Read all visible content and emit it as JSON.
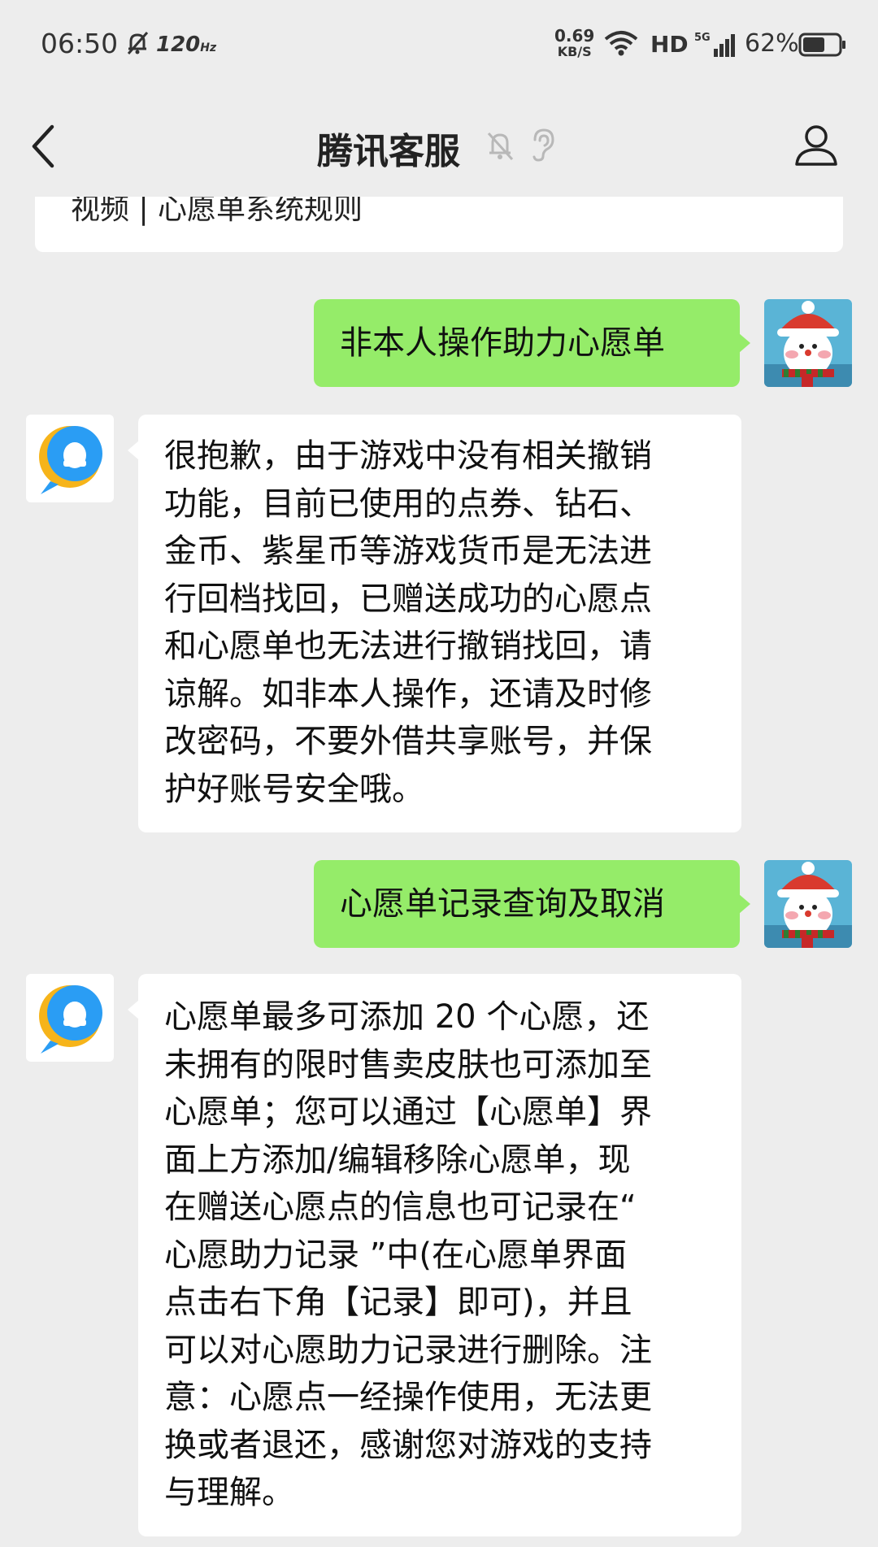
{
  "status_bar": {
    "time": "06:50",
    "refresh_rate": "120",
    "refresh_unit": "Hz",
    "net_speed_value": "0.69",
    "net_speed_unit": "KB/S",
    "hd_label": "HD",
    "network_label": "5G",
    "battery_percent": "62%",
    "battery_level": 0.62
  },
  "nav": {
    "title": "腾讯客服",
    "back_icon": "chevron-left-icon",
    "mute_icon": "bell-off-icon",
    "ear_icon": "ear-icon",
    "profile_icon": "person-icon"
  },
  "chat": {
    "partial_card_text": "视频 | 心愿单系统规则",
    "messages": [
      {
        "side": "out",
        "text": "非本人操作助力心愿单"
      },
      {
        "side": "in",
        "text": "很抱歉，由于游戏中没有相关撤销\n功能，目前已使用的点券、钻石、\n金币、紫星币等游戏货币是无法进\n行回档找回，已赠送成功的心愿点\n和心愿单也无法进行撤销找回，请\n谅解。如非本人操作，还请及时修\n改密码，不要外借共享账号，并保\n护好账号安全哦。"
      },
      {
        "side": "out",
        "text": "心愿单记录查询及取消"
      },
      {
        "side": "in",
        "text": "心愿单最多可添加 20 个心愿，还\n未拥有的限时售卖皮肤也可添加至\n心愿单；您可以通过【心愿单】界\n面上方添加/编辑移除心愿单，现\n在赠送心愿点的信息也可记录在“\n心愿助力记录 ”中(在心愿单界面\n点击右下角【记录】即可)，并且\n可以对心愿助力记录进行删除。注\n意：心愿点一经操作使用，无法更\n换或者退还，感谢您对游戏的支持\n与理解。"
      }
    ]
  },
  "colors": {
    "background": "#ededed",
    "outgoing_bubble": "#95ec69",
    "incoming_bubble": "#ffffff"
  }
}
